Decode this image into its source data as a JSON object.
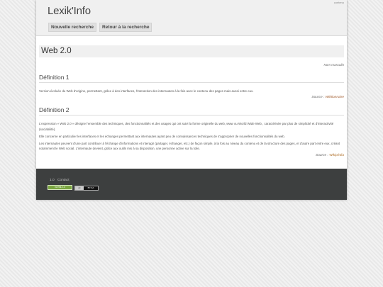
{
  "header": {
    "site_title": "Lexik'Info",
    "corner_link": "contenu",
    "nav": [
      "Nouvelle recherche",
      "Retour à la recherche"
    ]
  },
  "word": {
    "title": "Web 2.0",
    "gender": "Nom masculin"
  },
  "definitions": [
    {
      "title": "Définition 1",
      "paragraphs": [
        "Version évoluée du Web d'origine, permettant, grâce à des interfaces, l'interaction des internautes à la fois avec le contenu des pages mais aussi entre eux."
      ],
      "source_label": "Source :",
      "source_name": "Wiktionnaire"
    },
    {
      "title": "Définition 2",
      "paragraphs": [
        "L'expression « Web 2.0 » désigne l'ensemble des techniques, des fonctionnalités et des usages qui ont suivi la forme originelle du web, www ou World Wide Web , caractérisée par plus de simplicité et d'interactivité (sociabilité).",
        "Elle concerne en particulier les interfaces et les échanges permettant aux internautes ayant peu de connaissances techniques de s'approprier de nouvelles fonctionnalités du web.",
        "Les internautes peuvent d'une part contribuer à l'échange d'informations et interagir (partager, échanger, etc.) de façon simple, à la fois au niveau du contenu et de la structure des pages, et d'autre part entre eux, créant notamment le Web social. L'internaute devient, grâce aux outils mis à sa disposition, une personne active sur la toile."
      ],
      "source_label": "Source :",
      "source_name": "Wikipédia"
    }
  ],
  "footer": {
    "links": [
      "1.0",
      "Contact"
    ],
    "badge_xhtml": "XHTML 1.0",
    "badge_cc_mark": "cc",
    "badge_cc_text": "BY-SA"
  }
}
